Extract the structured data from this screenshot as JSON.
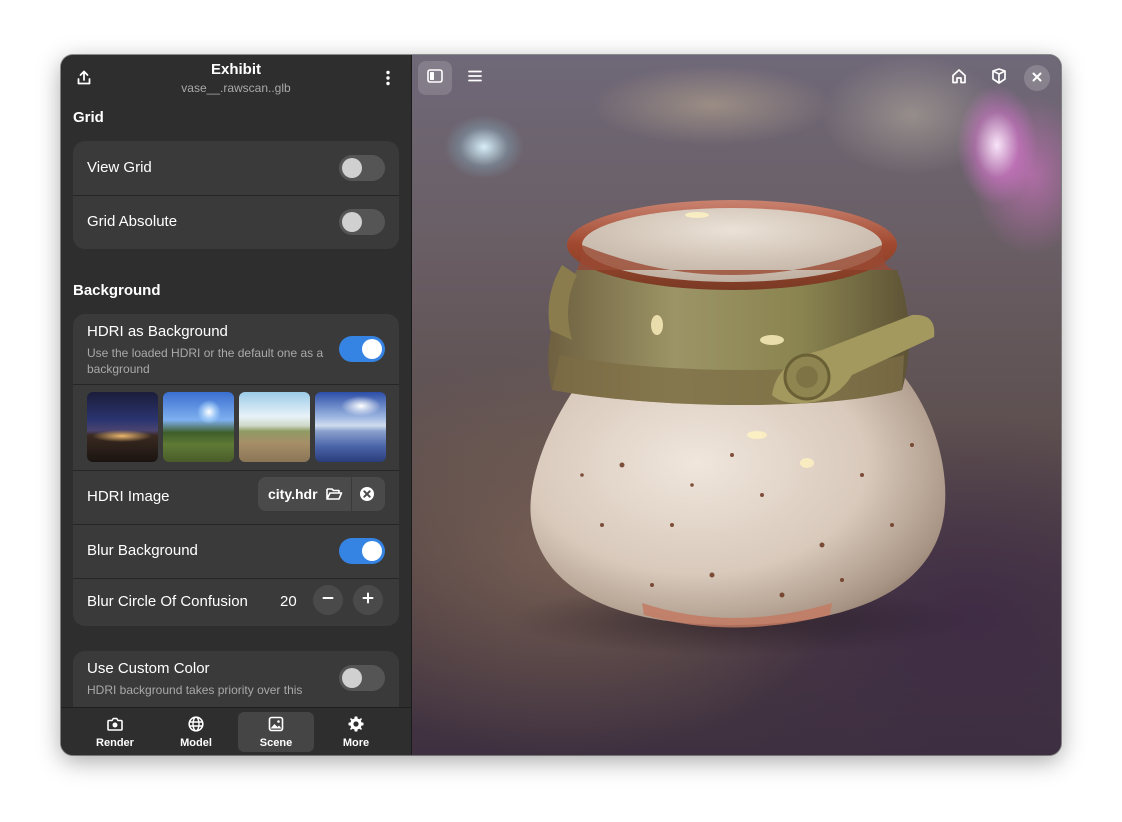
{
  "window": {
    "title": "Exhibit",
    "subtitle": "vase__.rawscan..glb"
  },
  "grid_section": {
    "title": "Grid",
    "rows": [
      {
        "label": "View Grid",
        "on": false
      },
      {
        "label": "Grid Absolute",
        "on": false
      }
    ]
  },
  "background_section": {
    "title": "Background",
    "hdri_bg": {
      "label": "HDRI as Background",
      "desc": "Use the loaded HDRI or the default one as a background",
      "on": true
    },
    "thumbnails": [
      "night-city",
      "green-park",
      "dirt-road",
      "sky-reflection"
    ],
    "hdri_image": {
      "label": "HDRI Image",
      "file": "city.hdr"
    },
    "blur_bg": {
      "label": "Blur Background",
      "on": true
    },
    "blur_coc": {
      "label": "Blur Circle Of Confusion",
      "value": "20"
    },
    "custom_color": {
      "label": "Use Custom Color",
      "desc": "HDRI background takes priority over this",
      "on": false
    }
  },
  "tabs": [
    {
      "label": "Render",
      "icon": "camera-icon",
      "active": false
    },
    {
      "label": "Model",
      "icon": "globe-icon",
      "active": false
    },
    {
      "label": "Scene",
      "icon": "image-icon",
      "active": true
    },
    {
      "label": "More",
      "icon": "gear-icon",
      "active": false
    }
  ],
  "colors": {
    "accent": "#3584e4",
    "sidebar_bg": "#2e2e2e",
    "card_bg": "#3a3a3a"
  }
}
